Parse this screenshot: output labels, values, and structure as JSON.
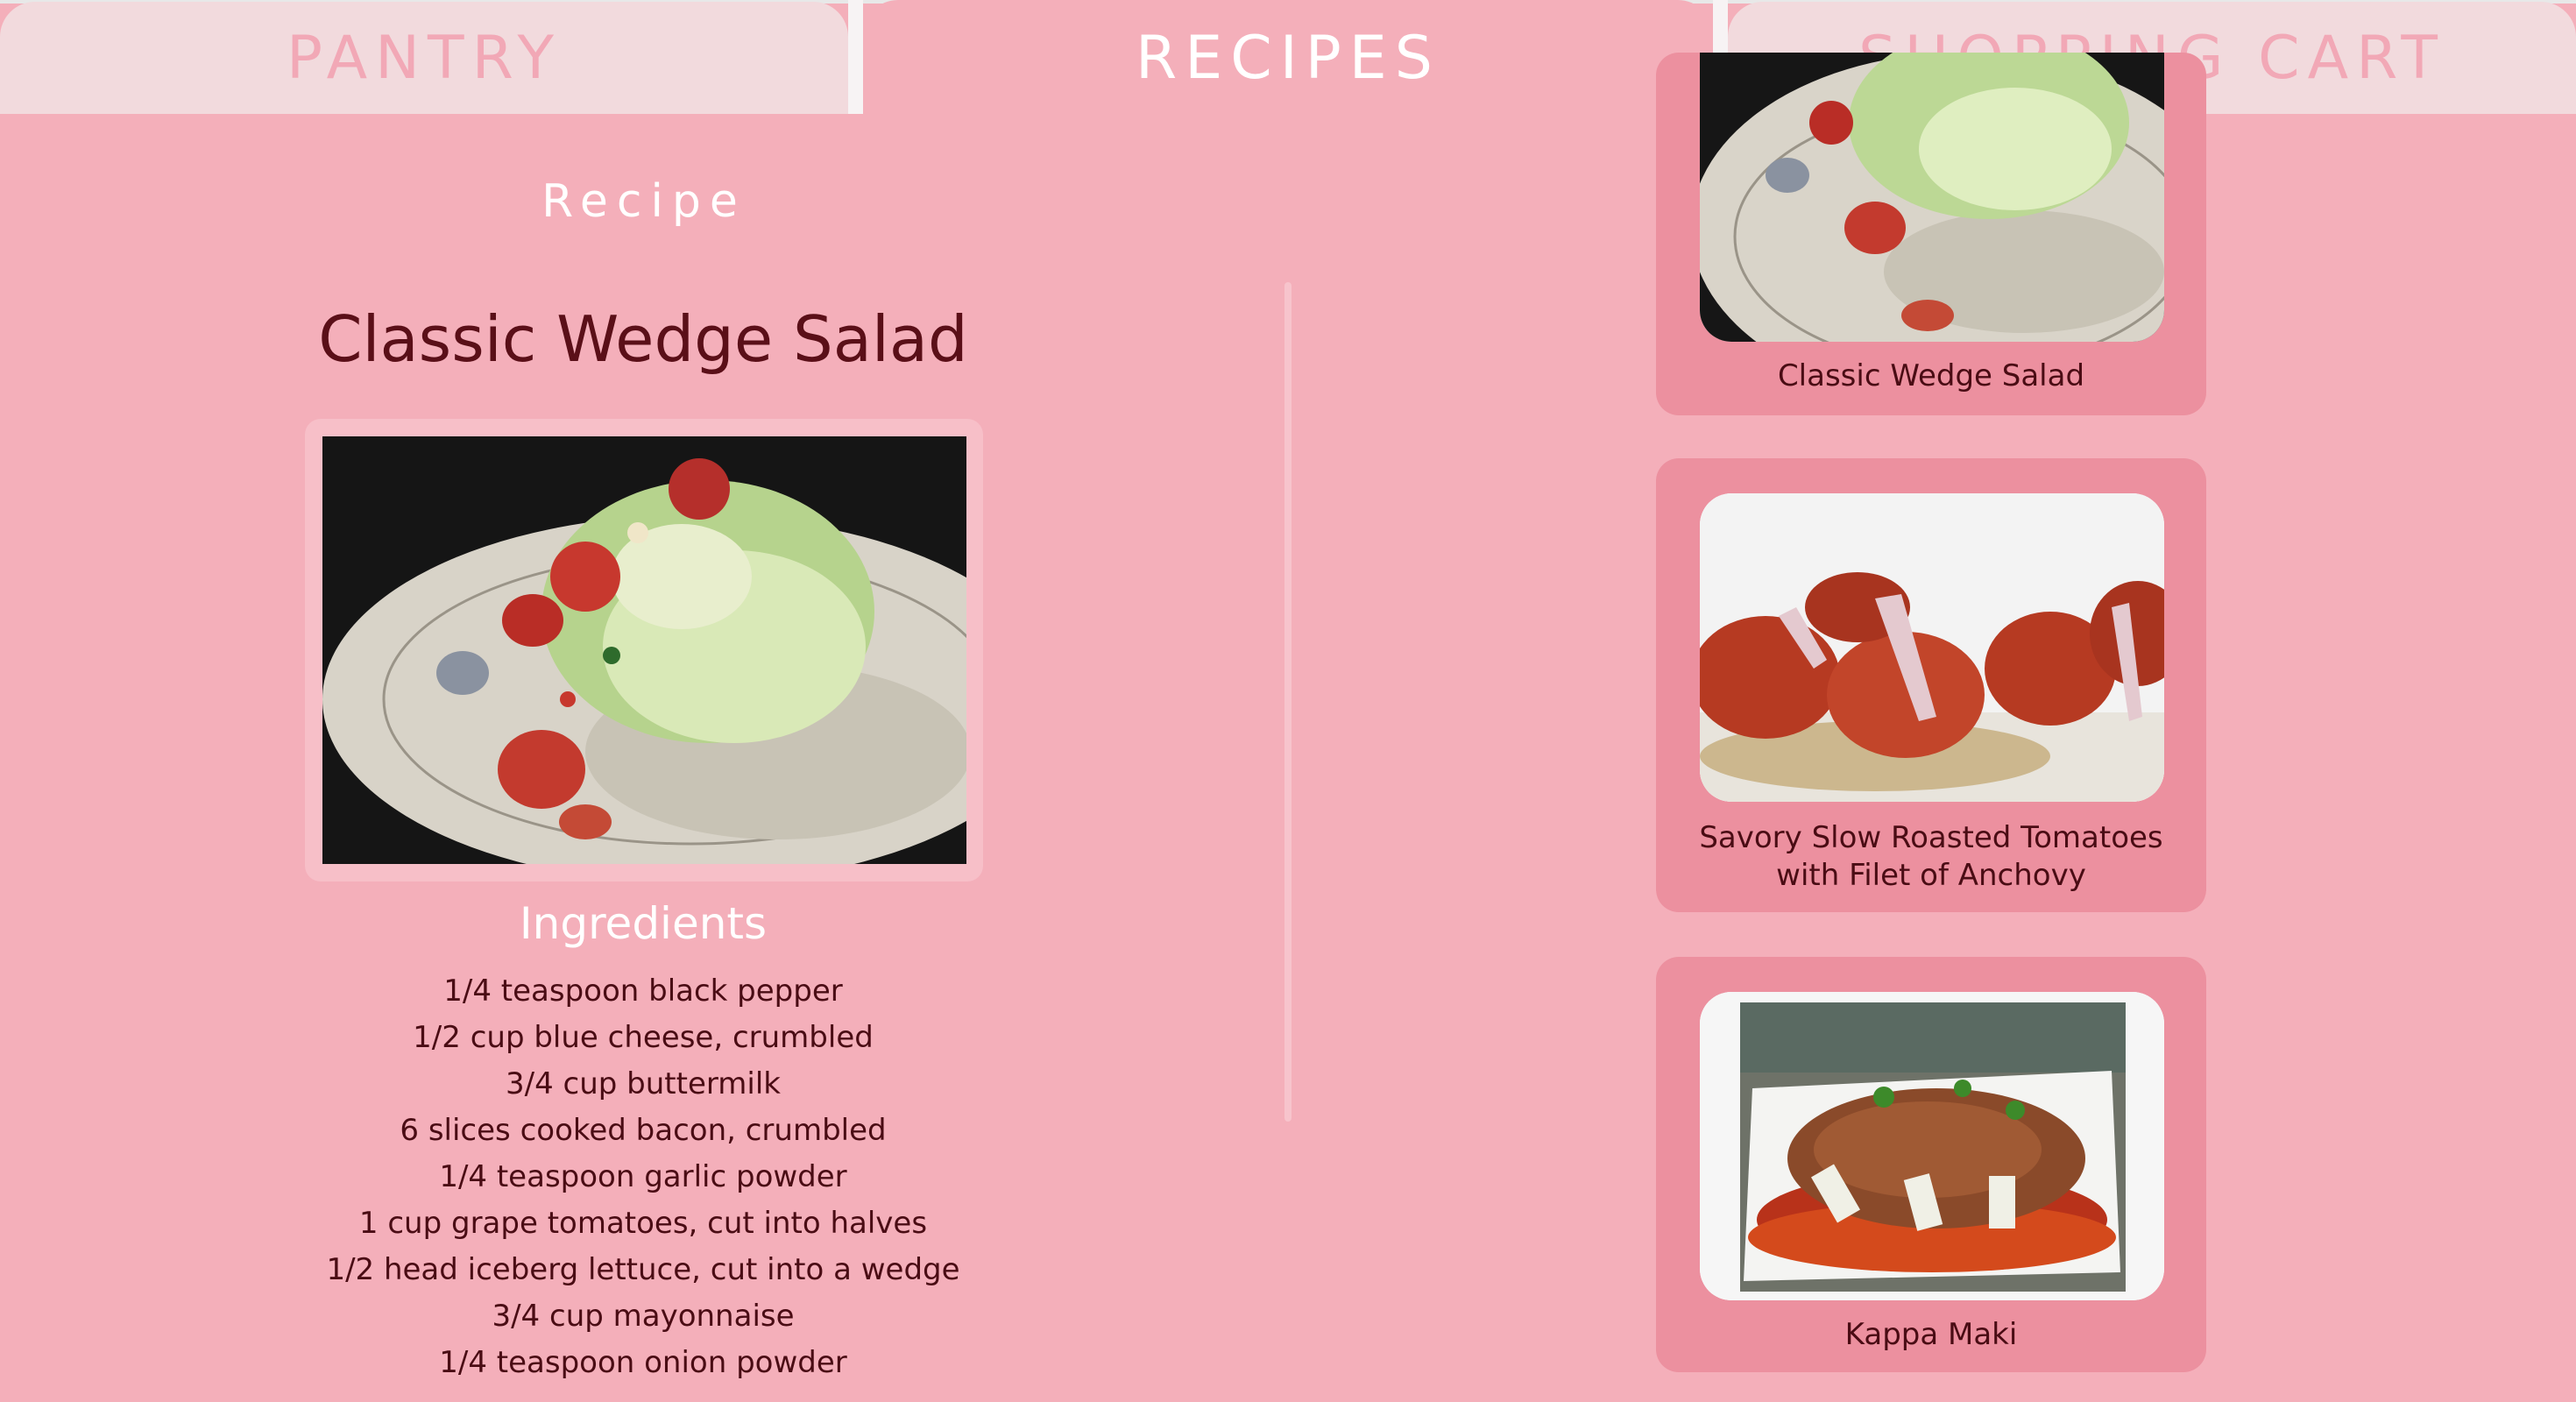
{
  "tabs": {
    "pantry": "PANTRY",
    "recipes": "RECIPES",
    "cart": "SHOPPING CART",
    "active": "recipes"
  },
  "recipe": {
    "section_heading": "Recipe",
    "title": "Classic Wedge Salad",
    "ingredients_heading": "Ingredients",
    "ingredients": [
      "1/4 teaspoon black pepper",
      "1/2 cup blue cheese, crumbled",
      "3/4 cup buttermilk",
      "6 slices cooked bacon, crumbled",
      "1/4 teaspoon garlic powder",
      "1 cup grape tomatoes, cut into halves",
      "1/2 head iceberg lettuce, cut into a wedge",
      "3/4 cup mayonnaise",
      "1/4 teaspoon onion powder"
    ]
  },
  "recipe_list": [
    {
      "label": "Classic Wedge Salad"
    },
    {
      "label": "Savory Slow Roasted Tomatoes with Filet of Anchovy"
    },
    {
      "label": "Kappa Maki"
    }
  ],
  "colors": {
    "background": "#f4afba",
    "card": "#ec909f",
    "inactive_tab": "#f2dadd",
    "title_text": "#5a0f18"
  }
}
